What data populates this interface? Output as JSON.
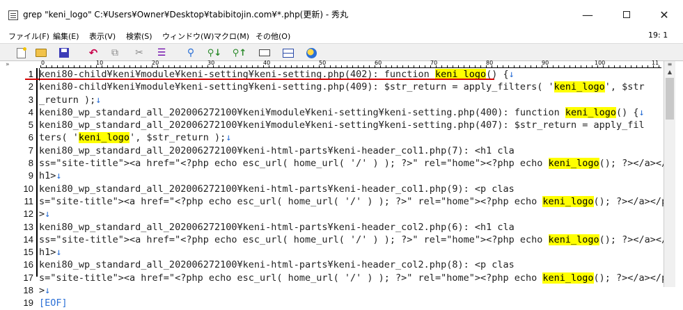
{
  "window": {
    "title": "grep \"keni_logo\" C:¥Users¥Owner¥Desktop¥tabibitojin.com¥*.php(更新) - 秀丸",
    "minimize": "—",
    "close": "✕"
  },
  "menu": {
    "items": [
      "ファイル(F)",
      "編集(E)",
      "表示(V)",
      "検索(S)",
      "ウィンドウ(W)",
      "マクロ(M)",
      "その他(O)"
    ],
    "cursor_position": "19: 1"
  },
  "toolbar": {
    "icons": [
      "new-file-icon",
      "open-folder-icon",
      "save-icon",
      "undo-icon",
      "copy-icon",
      "cut-icon",
      "paste-icon",
      "search-icon",
      "find-next-icon",
      "find-prev-icon",
      "window-icon",
      "split-icon",
      "globe-icon"
    ]
  },
  "ruler": {
    "labels": [
      "0",
      "10",
      "20",
      "30",
      "40",
      "50",
      "60",
      "70",
      "80",
      "90",
      "100",
      "11"
    ]
  },
  "highlight_term": "keni_logo",
  "lines": [
    {
      "n": "1",
      "parts": [
        [
          "t",
          "keni80-child¥keni¥module¥keni-setting¥keni-setting.php(402): function "
        ],
        [
          "h",
          "keni_logo"
        ],
        [
          "t",
          "() {"
        ],
        [
          "n",
          "↓"
        ]
      ]
    },
    {
      "n": "2",
      "parts": [
        [
          "t",
          "keni80-child¥keni¥module¥keni-setting¥keni-setting.php(409):      $str_return = apply_filters( '"
        ],
        [
          "h",
          "keni_logo"
        ],
        [
          "t",
          "', $str"
        ]
      ]
    },
    {
      "n": "3",
      "parts": [
        [
          "t",
          "_return );"
        ],
        [
          "n",
          "↓"
        ]
      ]
    },
    {
      "n": "4",
      "parts": [
        [
          "t",
          "keni80_wp_standard_all_202006272100¥keni¥module¥keni-setting¥keni-setting.php(400): function "
        ],
        [
          "h",
          "keni_logo"
        ],
        [
          "t",
          "() {"
        ],
        [
          "n",
          "↓"
        ]
      ]
    },
    {
      "n": "5",
      "parts": [
        [
          "t",
          "keni80_wp_standard_all_202006272100¥keni¥module¥keni-setting¥keni-setting.php(407):      $str_return = apply_fil"
        ]
      ]
    },
    {
      "n": "6",
      "parts": [
        [
          "t",
          "ters( '"
        ],
        [
          "h",
          "keni_logo"
        ],
        [
          "t",
          "', $str_return );"
        ],
        [
          "n",
          "↓"
        ]
      ]
    },
    {
      "n": "7",
      "parts": [
        [
          "t",
          "keni80_wp_standard_all_202006272100¥keni-html-parts¥keni-header_col1.php(7):                     <h1 cla"
        ]
      ]
    },
    {
      "n": "8",
      "parts": [
        [
          "t",
          "ss=\"site-title\"><a href=\"<?php echo esc_url( home_url( '/' ) ); ?>\" rel=\"home\"><?php echo "
        ],
        [
          "h",
          "keni_logo"
        ],
        [
          "t",
          "(); ?></a></"
        ]
      ]
    },
    {
      "n": "9",
      "parts": [
        [
          "t",
          "h1>"
        ],
        [
          "n",
          "↓"
        ]
      ]
    },
    {
      "n": "10",
      "parts": [
        [
          "t",
          "keni80_wp_standard_all_202006272100¥keni-html-parts¥keni-header_col1.php(9):                     <p clas"
        ]
      ]
    },
    {
      "n": "11",
      "parts": [
        [
          "t",
          "s=\"site-title\"><a href=\"<?php echo esc_url( home_url( '/' ) ); ?>\" rel=\"home\"><?php echo "
        ],
        [
          "h",
          "keni_logo"
        ],
        [
          "t",
          "(); ?></a></p"
        ]
      ]
    },
    {
      "n": "12",
      "parts": [
        [
          "t",
          ">"
        ],
        [
          "n",
          "↓"
        ]
      ]
    },
    {
      "n": "13",
      "parts": [
        [
          "t",
          "keni80_wp_standard_all_202006272100¥keni-html-parts¥keni-header_col2.php(6):                     <h1 cla"
        ]
      ]
    },
    {
      "n": "14",
      "parts": [
        [
          "t",
          "ss=\"site-title\"><a href=\"<?php echo esc_url( home_url( '/' ) ); ?>\" rel=\"home\"><?php echo "
        ],
        [
          "h",
          "keni_logo"
        ],
        [
          "t",
          "(); ?></a></"
        ]
      ]
    },
    {
      "n": "15",
      "parts": [
        [
          "t",
          "h1>"
        ],
        [
          "n",
          "↓"
        ]
      ]
    },
    {
      "n": "16",
      "parts": [
        [
          "t",
          "keni80_wp_standard_all_202006272100¥keni-html-parts¥keni-header_col2.php(8):                     <p clas"
        ]
      ]
    },
    {
      "n": "17",
      "parts": [
        [
          "t",
          "s=\"site-title\"><a href=\"<?php echo esc_url( home_url( '/' ) ); ?>\" rel=\"home\"><?php echo "
        ],
        [
          "h",
          "keni_logo"
        ],
        [
          "t",
          "(); ?></a></p"
        ]
      ]
    },
    {
      "n": "18",
      "parts": [
        [
          "t",
          ">"
        ],
        [
          "n",
          "↓"
        ]
      ]
    },
    {
      "n": "19",
      "parts": [
        [
          "e",
          "[EOF]"
        ]
      ]
    }
  ]
}
